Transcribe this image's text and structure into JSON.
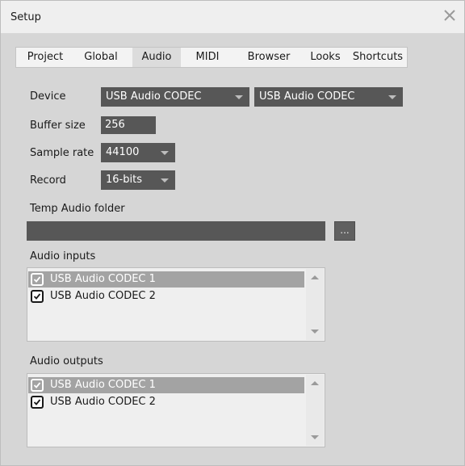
{
  "window": {
    "title": "Setup"
  },
  "tabs": [
    {
      "label": "Project"
    },
    {
      "label": "Global"
    },
    {
      "label": "Audio",
      "active": true
    },
    {
      "label": "MIDI"
    },
    {
      "label": "Browser"
    },
    {
      "label": "Looks"
    },
    {
      "label": "Shortcuts"
    }
  ],
  "audio": {
    "device_label": "Device",
    "device_input": "USB Audio CODEC",
    "device_output": "USB Audio CODEC",
    "buffer_label": "Buffer size",
    "buffer_value": "256",
    "sample_rate_label": "Sample rate",
    "sample_rate_value": "44100",
    "record_label": "Record",
    "record_value": "16-bits",
    "temp_folder_label": "Temp Audio folder",
    "temp_folder_value": "",
    "browse_label": "...",
    "inputs_label": "Audio inputs",
    "inputs": [
      {
        "label": "USB Audio CODEC  1",
        "checked": true,
        "selected": true
      },
      {
        "label": "USB Audio CODEC  2",
        "checked": true,
        "selected": false
      }
    ],
    "outputs_label": "Audio outputs",
    "outputs": [
      {
        "label": "USB Audio CODEC  1",
        "checked": true,
        "selected": true
      },
      {
        "label": "USB Audio CODEC  2",
        "checked": true,
        "selected": false
      }
    ]
  },
  "icons": {
    "close": "close-icon",
    "dropdown": "chevron-down-icon",
    "checkbox": "checkmark-icon",
    "scroll_up": "scroll-up-icon",
    "scroll_down": "scroll-down-icon"
  },
  "colors": {
    "panel": "#d6d6d6",
    "control_dark": "#575757",
    "selection": "#a3a3a3"
  }
}
